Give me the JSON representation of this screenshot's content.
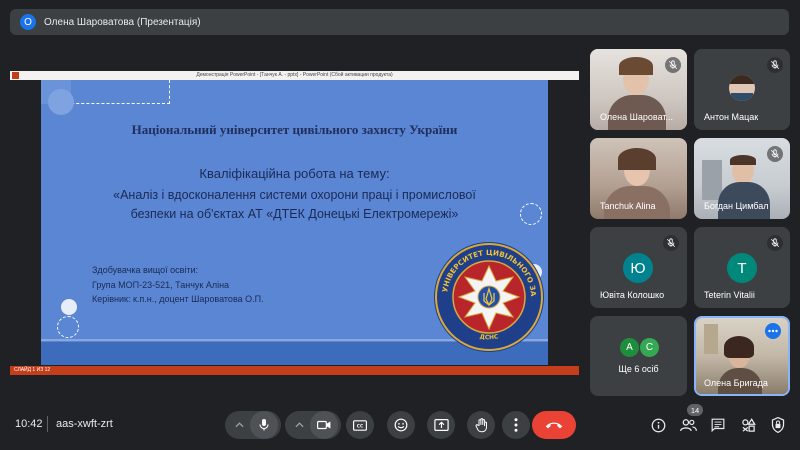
{
  "presenter": {
    "avatar_letter": "O",
    "label": "Олена Шароватова (Презентація)"
  },
  "ppt": {
    "window_title": "Демонстрація PowerPoint - [Танчук А. - pptx] - PowerPoint (Сбой активации продукта)",
    "status": "СЛАЙД 1 ИЗ 12"
  },
  "slide": {
    "university": "Національний університет цивільного захисту України",
    "heading": "Кваліфікаційна робота на тему:",
    "topic_line1": "«Аналіз і вдосконалення системи охорони праці і промислової",
    "topic_line2": "безпеки на об'єктах АТ «ДТЕК Донецькі Електромережі»",
    "info_line1": "Здобувачка вищої освіти:",
    "info_line2": "Група МОП-23-521, Танчук Аліна",
    "info_line3": "Керівник: к.п.н., доцент Шароватова О.П.",
    "emblem_top": "НАЦІОНАЛЬНИЙ УНІВЕРСИТЕТ ЦИВІЛЬНОГО ЗАХИСТУ УКРАЇНИ",
    "emblem_bottom": "ДСНС"
  },
  "participants": [
    {
      "name": "Олена Шароват...",
      "kind": "video"
    },
    {
      "name": "Антон Мацак",
      "kind": "video"
    },
    {
      "name": "Tanchuk Alina",
      "kind": "video"
    },
    {
      "name": "Богдан Цимбал",
      "kind": "video"
    },
    {
      "name": "Ювіта Колошко",
      "kind": "avatar",
      "letter": "Ю",
      "color": "#00838f"
    },
    {
      "name": "Teterin Vitalii",
      "kind": "avatar",
      "letter": "T",
      "color": "#00897b"
    },
    {
      "name": "Олена Бригада",
      "kind": "video"
    }
  ],
  "more_tile": {
    "label": "Ще 6 осіб",
    "letter1": "A",
    "color1": "#1e8e3e",
    "letter2": "C",
    "color2": "#34a853"
  },
  "bottom": {
    "time": "10:42",
    "meeting_code": "aas-xwft-zrt",
    "people_count": "14",
    "end_color": "#ea4335"
  },
  "icons": [
    "mic-off-icon",
    "mic-icon",
    "camera-icon",
    "captions-icon",
    "emoji-icon",
    "present-icon",
    "hand-icon",
    "more-vert-icon",
    "end-call-icon",
    "info-icon",
    "people-icon",
    "chat-icon",
    "activities-icon",
    "host-controls-icon",
    "chevron-up-icon"
  ]
}
